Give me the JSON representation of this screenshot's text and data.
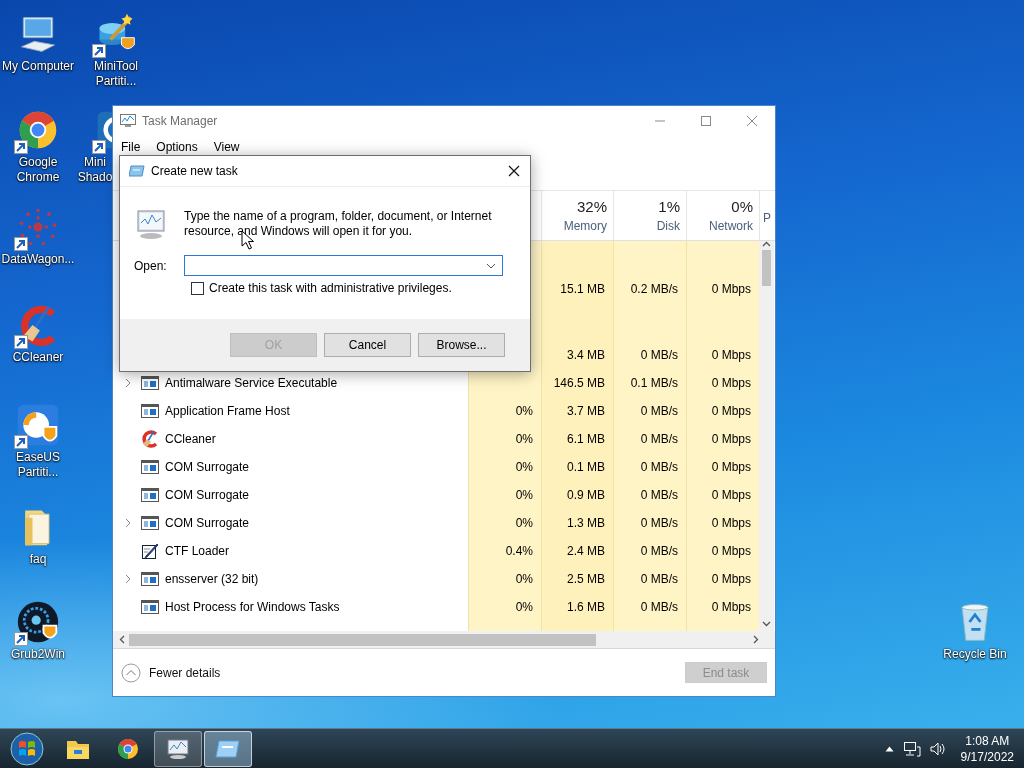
{
  "desktop_icons": [
    {
      "label": "My Computer",
      "kind": "computer",
      "shortcut": false
    },
    {
      "label": "MiniTool Partiti...",
      "kind": "minitool",
      "shortcut": true
    },
    {
      "label": "Google Chrome",
      "kind": "chrome",
      "shortcut": true
    },
    {
      "label": "Mini Shado",
      "kind": "shadow",
      "shortcut": true
    },
    {
      "label": "DataWagon...",
      "kind": "datawagon",
      "shortcut": true
    },
    {
      "label": "CCleaner",
      "kind": "ccleaner",
      "shortcut": true
    },
    {
      "label": "EaseUS Partiti...",
      "kind": "easeus",
      "shortcut": true
    },
    {
      "label": "faq",
      "kind": "folder",
      "shortcut": false
    },
    {
      "label": "Grub2Win",
      "kind": "grub",
      "shortcut": true
    },
    {
      "label": "Recycle Bin",
      "kind": "recycle",
      "shortcut": false
    }
  ],
  "task_manager": {
    "title": "Task Manager",
    "menu": [
      "File",
      "Options",
      "View"
    ],
    "columns": [
      {
        "percent": "32%",
        "label": "Memory"
      },
      {
        "percent": "1%",
        "label": "Disk"
      },
      {
        "percent": "0%",
        "label": "Network"
      },
      {
        "label": "P"
      }
    ],
    "rows": [
      {
        "memory": "15.1 MB",
        "disk": "0.2 MB/s",
        "network": "0 Mbps"
      },
      {
        "memory": "3.4 MB",
        "disk": "0 MB/s",
        "network": "0 Mbps"
      },
      {
        "name": "Antimalware Service Executable",
        "kind": "window",
        "expandable": true,
        "memory": "146.5 MB",
        "disk": "0.1 MB/s",
        "network": "0 Mbps"
      },
      {
        "name": "Application Frame Host",
        "kind": "window",
        "expandable": false,
        "cpu": "0%",
        "memory": "3.7 MB",
        "disk": "0 MB/s",
        "network": "0 Mbps"
      },
      {
        "name": "CCleaner",
        "kind": "ccleaner",
        "expandable": false,
        "cpu": "0%",
        "memory": "6.1 MB",
        "disk": "0 MB/s",
        "network": "0 Mbps"
      },
      {
        "name": "COM Surrogate",
        "kind": "window",
        "expandable": false,
        "cpu": "0%",
        "memory": "0.1 MB",
        "disk": "0 MB/s",
        "network": "0 Mbps"
      },
      {
        "name": "COM Surrogate",
        "kind": "window",
        "expandable": false,
        "cpu": "0%",
        "memory": "0.9 MB",
        "disk": "0 MB/s",
        "network": "0 Mbps"
      },
      {
        "name": "COM Surrogate",
        "kind": "window",
        "expandable": true,
        "cpu": "0%",
        "memory": "1.3 MB",
        "disk": "0 MB/s",
        "network": "0 Mbps"
      },
      {
        "name": "CTF Loader",
        "kind": "pen",
        "expandable": false,
        "cpu": "0.4%",
        "memory": "2.4 MB",
        "disk": "0 MB/s",
        "network": "0 Mbps"
      },
      {
        "name": "ensserver (32 bit)",
        "kind": "window",
        "expandable": true,
        "cpu": "0%",
        "memory": "2.5 MB",
        "disk": "0 MB/s",
        "network": "0 Mbps"
      },
      {
        "name": "Host Process for Windows Tasks",
        "kind": "window",
        "expandable": false,
        "cpu": "0%",
        "memory": "1.6 MB",
        "disk": "0 MB/s",
        "network": "0 Mbps"
      }
    ],
    "fewer_details": "Fewer details",
    "end_task": {
      "label": "End task",
      "disabled": true
    }
  },
  "run_dialog": {
    "title": "Create new task",
    "message": "Type the name of a program, folder, document, or Internet resource, and Windows will open it for you.",
    "open_label": "Open:",
    "admin_checkbox": {
      "label": "Create this task with administrative privileges.",
      "checked": false
    },
    "buttons": [
      {
        "label": "OK",
        "disabled": true
      },
      {
        "label": "Cancel",
        "disabled": false
      },
      {
        "label": "Browse...",
        "disabled": false
      }
    ]
  },
  "taskbar": {
    "apps": [
      {
        "kind": "folder",
        "running": false,
        "selected": false
      },
      {
        "kind": "chrome",
        "running": false,
        "selected": false
      },
      {
        "kind": "taskmanager",
        "running": true,
        "selected": false
      },
      {
        "kind": "run",
        "running": true,
        "selected": true
      }
    ],
    "clock": {
      "time": "1:08 AM",
      "date": "9/17/2022"
    }
  }
}
